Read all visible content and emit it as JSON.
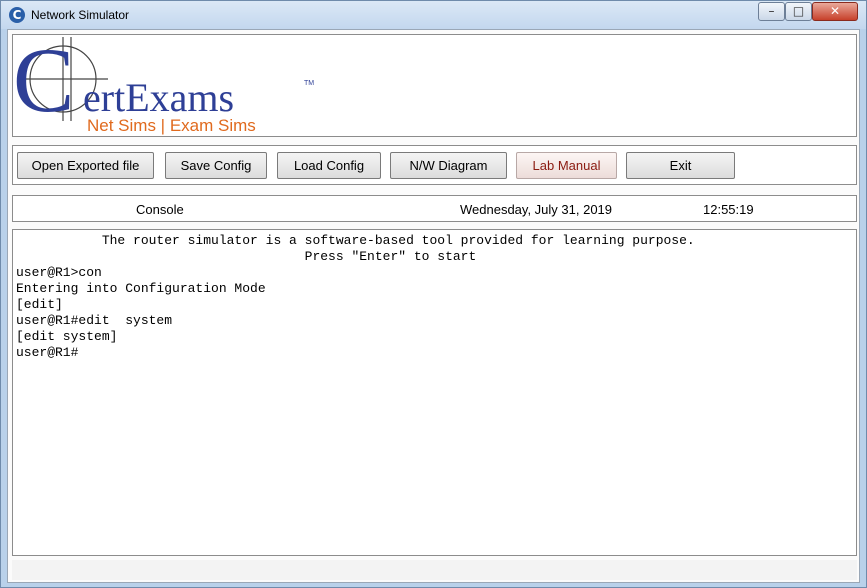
{
  "window": {
    "title": "Network Simulator",
    "controls": {
      "minimize": "–",
      "maximize": "□",
      "close": "✕"
    }
  },
  "logo": {
    "brand_letter": "C",
    "brand_rest": "ertExams",
    "trademark": "TM",
    "tagline": "Net Sims | Exam Sims",
    "colors": {
      "brand": "#2e3f96",
      "tagline": "#e06a1e",
      "crosshair": "#444444"
    }
  },
  "toolbar": {
    "open_exported": "Open Exported file",
    "save_config": "Save Config",
    "load_config": "Load Config",
    "nw_diagram": "N/W Diagram",
    "lab_manual": "Lab Manual",
    "exit": "Exit"
  },
  "status": {
    "mode": "Console",
    "date": "Wednesday, July 31, 2019",
    "time": "12:55:19"
  },
  "console": {
    "lines": [
      "           The router simulator is a software-based tool provided for learning purpose.",
      "                                     Press \"Enter\" to start",
      "user@R1>con",
      "Entering into Configuration Mode",
      "[edit]",
      "user@R1#edit  system",
      "[edit system]",
      "user@R1#"
    ]
  }
}
